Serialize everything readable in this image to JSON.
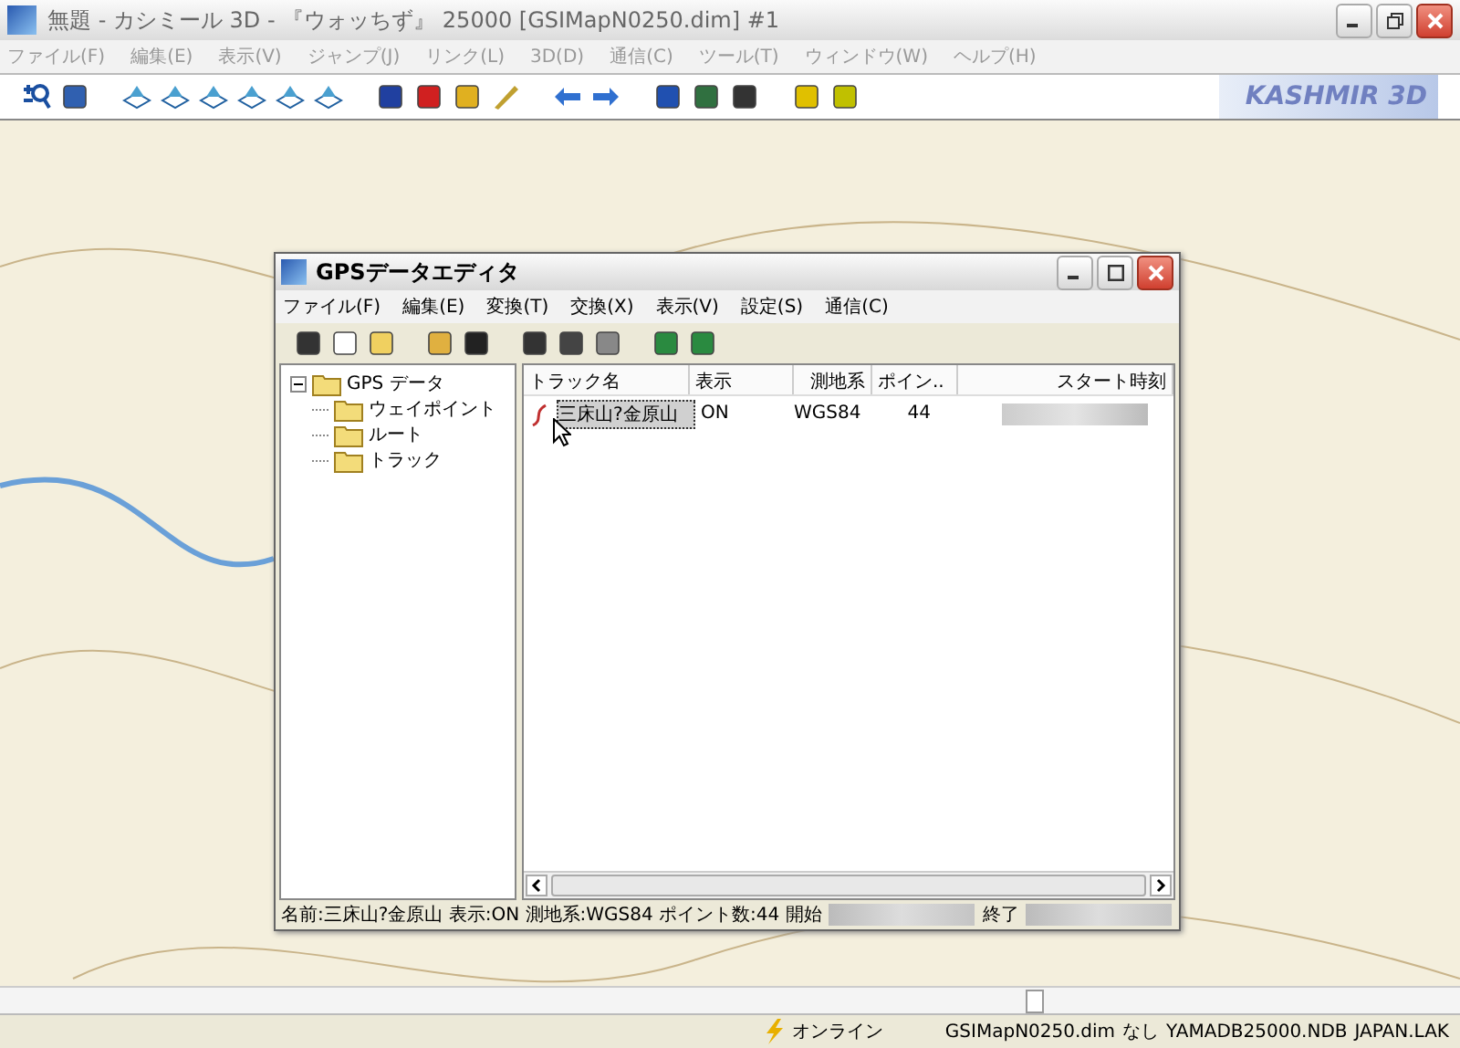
{
  "window": {
    "title": "無題 - カシミール 3D - 『ウォッちず』 25000 [GSIMapN0250.dim] #1"
  },
  "menu": [
    {
      "label": "ファイル(F)"
    },
    {
      "label": "編集(E)"
    },
    {
      "label": "表示(V)"
    },
    {
      "label": "ジャンプ(J)"
    },
    {
      "label": "リンク(L)"
    },
    {
      "label": "3D(D)"
    },
    {
      "label": "通信(C)"
    },
    {
      "label": "ツール(T)"
    },
    {
      "label": "ウィンドウ(W)"
    },
    {
      "label": "ヘルプ(H)"
    }
  ],
  "logo": "KASHMIR 3D",
  "dialog": {
    "title": "GPSデータエディタ",
    "menu": [
      {
        "label": "ファイル(F)"
      },
      {
        "label": "編集(E)"
      },
      {
        "label": "変換(T)"
      },
      {
        "label": "交換(X)"
      },
      {
        "label": "表示(V)"
      },
      {
        "label": "設定(S)"
      },
      {
        "label": "通信(C)"
      }
    ],
    "tree": [
      {
        "label": "GPS データ",
        "expanded": true,
        "children": [
          {
            "label": "ウェイポイント"
          },
          {
            "label": "ルート"
          },
          {
            "label": "トラック"
          }
        ]
      }
    ],
    "table": {
      "columns": [
        "トラック名",
        "表示",
        "測地系",
        "ポイン..",
        "スタート時刻"
      ],
      "rows": [
        {
          "cells": [
            "三床山?金原山",
            "ON",
            "WGS84",
            "44"
          ],
          "selected": true
        }
      ]
    },
    "status": {
      "text": "名前:三床山?金原山 表示:ON 測地系:WGS84 ポイント数:44 開始",
      "end_label": "終了"
    }
  },
  "status_bar": [
    "オンライン",
    "GSIMapN0250.dim",
    "なし",
    "YAMADB25000.NDB",
    "JAPAN.LAK"
  ]
}
